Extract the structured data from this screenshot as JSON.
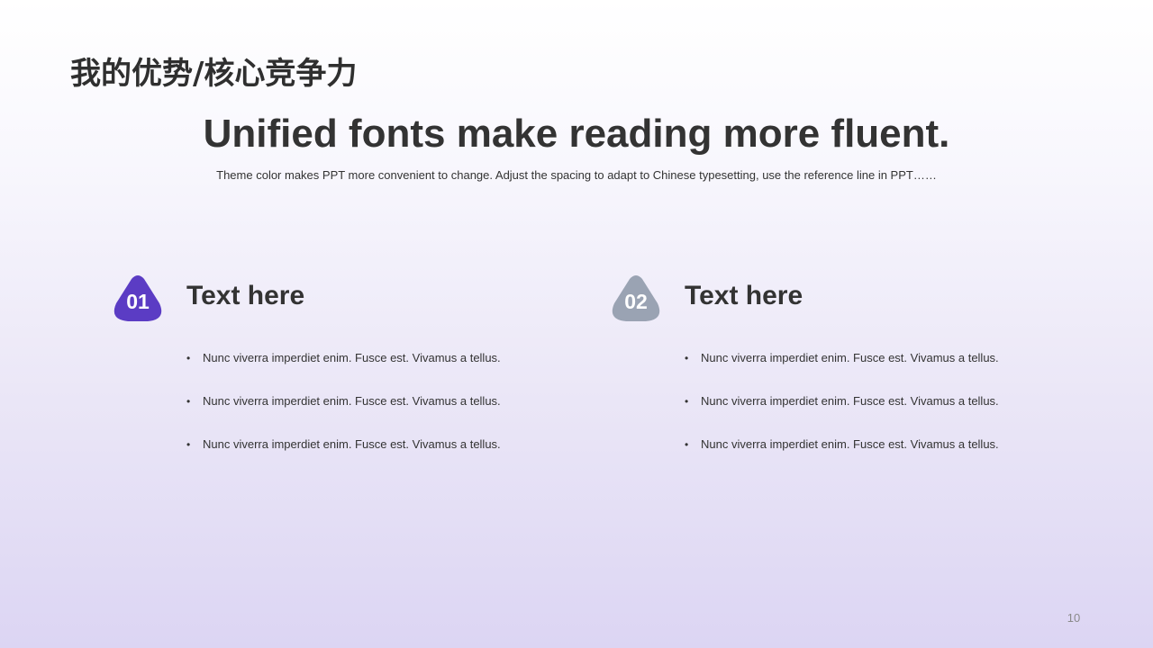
{
  "title": "我的优势/核心竞争力",
  "headline": "Unified fonts make reading more fluent.",
  "subline": "Theme color makes PPT more convenient to change. Adjust the spacing to adapt to Chinese typesetting, use the reference line in PPT……",
  "colors": {
    "accent_purple": "#5b3cc4",
    "accent_gray": "#9aa3b3",
    "text_dark": "#333333",
    "background_top": "#ffffff",
    "background_bottom": "#dcd5f3"
  },
  "columns": [
    {
      "number": "01",
      "heading": "Text here",
      "badge_color": "#5b3cc4",
      "bullets": [
        "Nunc viverra imperdiet enim. Fusce est. Vivamus a tellus.",
        "Nunc viverra imperdiet enim. Fusce est. Vivamus a tellus.",
        "Nunc viverra imperdiet enim. Fusce est. Vivamus a tellus."
      ]
    },
    {
      "number": "02",
      "heading": "Text here",
      "badge_color": "#9aa3b3",
      "bullets": [
        "Nunc viverra imperdiet enim. Fusce est. Vivamus a tellus.",
        "Nunc viverra imperdiet enim. Fusce est. Vivamus a tellus.",
        "Nunc viverra imperdiet enim. Fusce est. Vivamus a tellus."
      ]
    }
  ],
  "bullet_glyph": "•",
  "page_number": "10"
}
